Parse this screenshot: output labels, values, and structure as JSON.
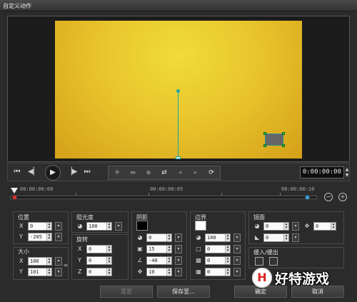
{
  "window": {
    "title": "自定义动作"
  },
  "colors": {
    "canvas_center": "#f0dc3a",
    "canvas_edge": "#d4a019",
    "accent": "#1aa8a8",
    "keyframe": "#2cc24a"
  },
  "transport": {
    "icons": [
      "go-to-start-icon",
      "previous-frame-icon",
      "play-icon",
      "next-frame-icon",
      "go-to-end-icon"
    ],
    "keyframe_tools": [
      "add-keyframe-icon",
      "remove-keyframe-icon",
      "invert-keyframe-icon",
      "move-keyframe-icon",
      "previous-keyframe-icon",
      "next-keyframe-icon",
      "copy-keyframe-icon"
    ],
    "timecode": "0:00:00:00"
  },
  "timeline": {
    "labels": [
      "00:00:00:00",
      "00:00:00:05",
      "00:00:00:10"
    ],
    "zoom_out": "−",
    "zoom_in": "+"
  },
  "position": {
    "title": "位置",
    "x_label": "X",
    "x": "0",
    "y_label": "Y",
    "y": "-205"
  },
  "size": {
    "title": "大小",
    "x_label": "X",
    "x": "100",
    "y_label": "Y",
    "y": "101"
  },
  "opacity": {
    "title": "阻光度",
    "value": "100"
  },
  "rotation": {
    "title": "旋转",
    "x_label": "X",
    "x": "0",
    "y_label": "Y",
    "y": "0",
    "z_label": "Z",
    "z": "0"
  },
  "shadow": {
    "title": "阴影",
    "color": "#000000",
    "opacity": "0",
    "blur": "15",
    "angle": "-40",
    "distance": "10"
  },
  "border": {
    "title": "边界",
    "color": "#ffffff",
    "opacity": "100",
    "width": "0",
    "blur": "0",
    "value3": "0"
  },
  "mirror": {
    "title": "镜面",
    "opacity": "0",
    "distance": "0",
    "offset": "0"
  },
  "fade": {
    "title": "缓入/缓出"
  },
  "footer": {
    "reset": "重置",
    "save_to": "保存至...",
    "ok": "确定",
    "cancel": "取消"
  },
  "watermark": {
    "text": "好特游戏"
  }
}
